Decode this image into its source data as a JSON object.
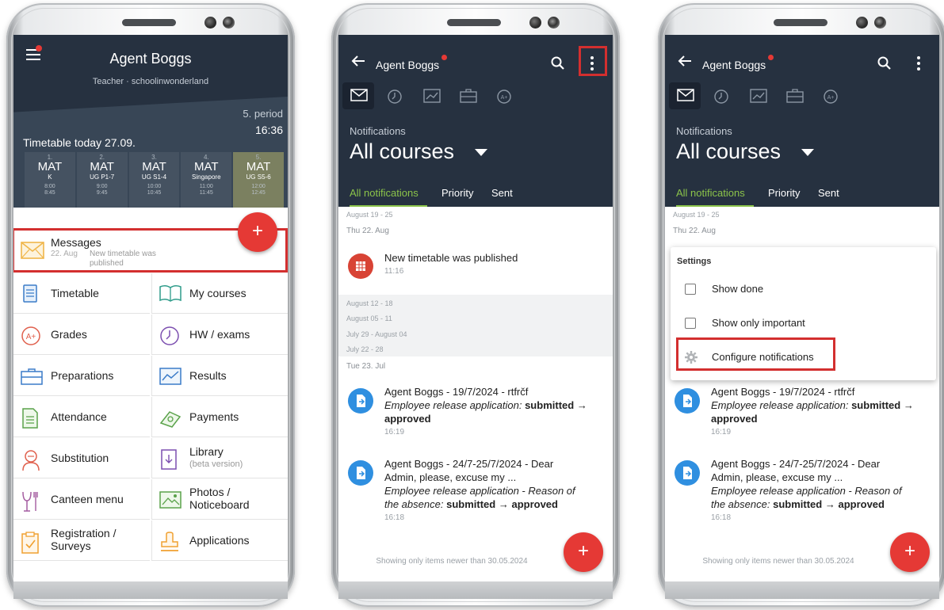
{
  "phone1": {
    "header": {
      "title": "Agent Boggs",
      "subtitle": "Teacher · schoolinwonderland"
    },
    "period": {
      "label": "5. period",
      "time": "16:36"
    },
    "timetable_label": "Timetable today 27.09.",
    "lessons": [
      {
        "num": "1.",
        "subject": "MAT",
        "room": "K",
        "start": "8:00",
        "end": "8:45",
        "current": false
      },
      {
        "num": "2.",
        "subject": "MAT",
        "room": "UG P1-7",
        "start": "9:00",
        "end": "9:45",
        "current": false
      },
      {
        "num": "3.",
        "subject": "MAT",
        "room": "UG S1-4",
        "start": "10:00",
        "end": "10:45",
        "current": false
      },
      {
        "num": "4.",
        "subject": "MAT",
        "room": "Singapore",
        "start": "11:00",
        "end": "11:45",
        "current": false
      },
      {
        "num": "5.",
        "subject": "MAT",
        "room": "UG S5-6",
        "start": "12:00",
        "end": "12:45",
        "current": true
      }
    ],
    "fab_label": "+",
    "messages": {
      "label": "Messages",
      "date": "22. Aug",
      "preview": "New timetable was published"
    },
    "menu": [
      {
        "label": "Timetable",
        "icon": "timetable-icon"
      },
      {
        "label": "My courses",
        "icon": "book-icon"
      },
      {
        "label": "Grades",
        "icon": "grades-icon"
      },
      {
        "label": "HW / exams",
        "icon": "clock-icon"
      },
      {
        "label": "Preparations",
        "icon": "briefcase-icon"
      },
      {
        "label": "Results",
        "icon": "chart-icon"
      },
      {
        "label": "Attendance",
        "icon": "attendance-icon"
      },
      {
        "label": "Payments",
        "icon": "money-icon"
      },
      {
        "label": "Substitution",
        "icon": "substitution-icon"
      },
      {
        "label": "Library",
        "sub": "(beta version)",
        "icon": "library-icon"
      },
      {
        "label": "Canteen menu",
        "icon": "canteen-icon"
      },
      {
        "label": "Photos / Noticeboard",
        "line1": "Photos /",
        "line2": "Noticeboard",
        "icon": "photos-icon"
      },
      {
        "label": "Registration / Surveys",
        "line1": "Registration /",
        "line2": "Surveys",
        "icon": "registration-icon"
      },
      {
        "label": "Applications",
        "icon": "stamp-icon"
      }
    ]
  },
  "notifications": {
    "title": "Agent Boggs",
    "caption": "Notifications",
    "courses": "All courses",
    "tabs": [
      "All notifications",
      "Priority",
      "Sent"
    ],
    "week1": "August 19 - 25",
    "day1": "Thu 22. Aug",
    "item1": {
      "title": "New timetable was published",
      "time": "11:16"
    },
    "weeks": [
      "August 12 - 18",
      "August 05 - 11",
      "July 29 - August 04",
      "July 22 - 28"
    ],
    "day2": "Tue 23. Jul",
    "item2": {
      "title": "Agent Boggs - 19/7/2024 - rtfrčf",
      "app": "Employee release application",
      "state_from": "submitted",
      "arrow": "→",
      "state_to": "approved",
      "time": "16:19"
    },
    "item3": {
      "title": "Agent Boggs - 24/7-25/7/2024 - Dear Admin, please, excuse my ...",
      "line1": "Agent Boggs - 24/7-25/7/2024 - Dear",
      "line2": "Admin, please, excuse my ...",
      "app": "Employee release application - Reason of the absence",
      "app1": "Employee release application - Reason of",
      "app2": "the absence",
      "state_from": "submitted",
      "arrow": "→",
      "state_to": "approved",
      "time": "16:18"
    },
    "footer": "Showing only items newer than 30.05.2024",
    "fab_label": "+"
  },
  "settings_menu": {
    "header": "Settings",
    "options": [
      "Show done",
      "Show only important",
      "Configure notifications"
    ]
  },
  "colors": {
    "header": "#263140",
    "accent_green": "#8bc34a",
    "fab": "#e53935",
    "highlight": "#d32f2f"
  }
}
